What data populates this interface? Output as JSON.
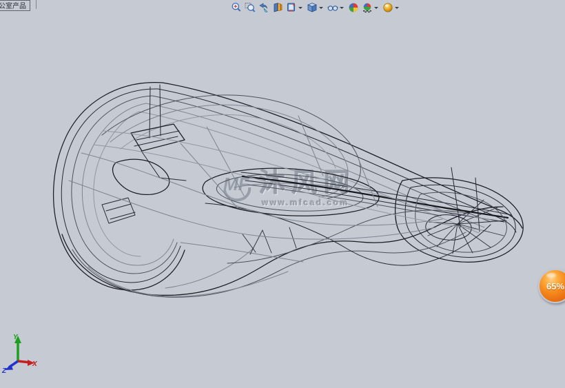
{
  "tab": {
    "label": "公室产品"
  },
  "toolbar": {
    "items": [
      {
        "name": "zoom-to-fit",
        "has_dropdown": false
      },
      {
        "name": "zoom-to-area",
        "has_dropdown": false
      },
      {
        "name": "previous-view",
        "has_dropdown": false
      },
      {
        "name": "section-view",
        "has_dropdown": false
      },
      {
        "name": "view-orientation",
        "has_dropdown": true
      },
      {
        "name": "display-style",
        "has_dropdown": true
      },
      {
        "name": "hide-show-items",
        "has_dropdown": true
      },
      {
        "name": "edit-appearance",
        "has_dropdown": false
      },
      {
        "name": "apply-scene",
        "has_dropdown": true
      },
      {
        "name": "view-settings",
        "has_dropdown": true
      }
    ]
  },
  "viewport": {
    "model": "bicycle-saddle-wireframe",
    "display_style": "wireframe"
  },
  "watermark": {
    "logo": "MF",
    "title": "沐风网",
    "url": "www.mfcad.com"
  },
  "zoom_badge": {
    "value": "65%"
  },
  "triad": {
    "x_label": "X",
    "y_label": "Y",
    "z_label": "Z",
    "x_color": "#c42020",
    "y_color": "#1d9e1d",
    "z_color": "#2233cc"
  },
  "colors": {
    "background": "#c6cad3",
    "wire_dark": "#24272d",
    "wire_gray": "#7e8490",
    "badge_orange": "#f68a1e",
    "watermark_gray": "#989ea9"
  }
}
